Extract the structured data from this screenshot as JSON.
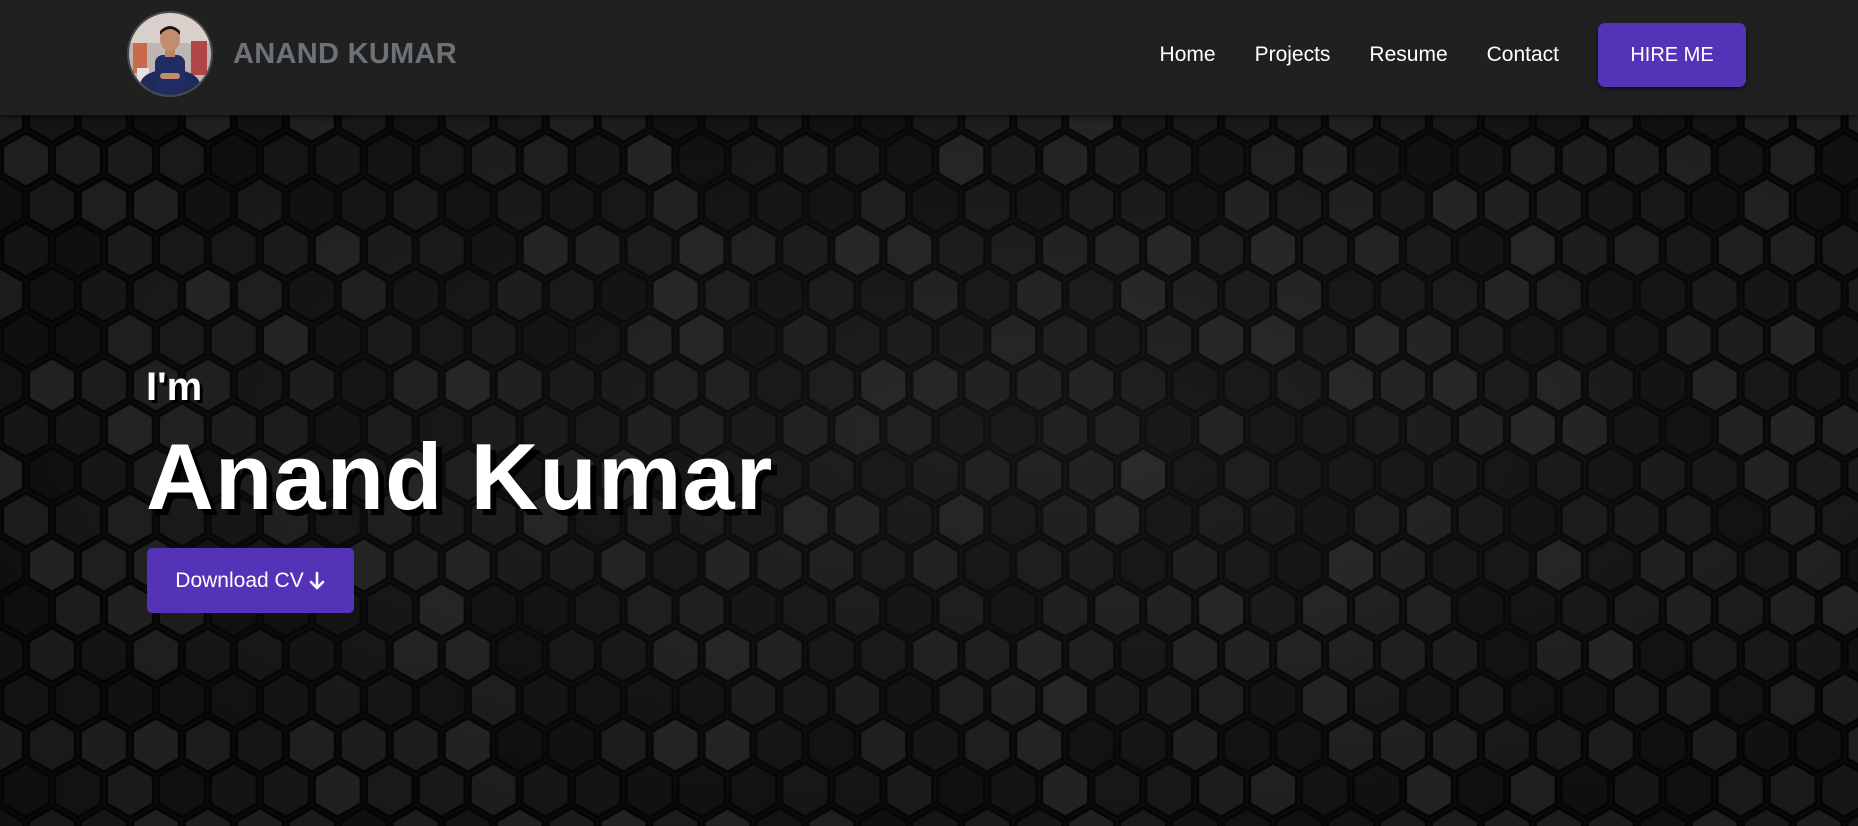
{
  "header": {
    "brand_name": "ANAND KUMAR",
    "avatar_icon": "profile-photo-avatar",
    "nav": [
      {
        "label": "Home"
      },
      {
        "label": "Projects"
      },
      {
        "label": "Resume"
      },
      {
        "label": "Contact"
      }
    ],
    "cta_label": "HIRE ME"
  },
  "hero": {
    "greeting": "I'm",
    "name": "Anand Kumar",
    "download_label": "Download CV",
    "download_icon": "arrow-down-icon"
  },
  "colors": {
    "accent": "#5533b8",
    "navbar_bg": "#202021",
    "hero_bg": "#0a0a0b",
    "brand_text": "#6d7277"
  }
}
